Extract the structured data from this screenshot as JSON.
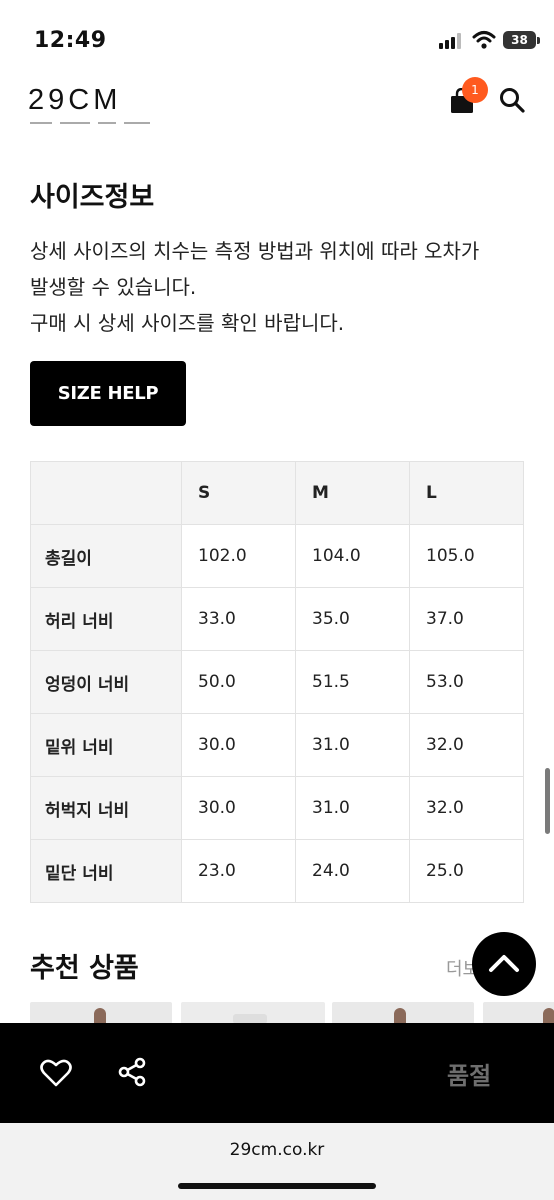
{
  "status_bar": {
    "time": "12:49",
    "battery": "38"
  },
  "header": {
    "logo": "29CM",
    "cart_count": "1"
  },
  "size_info": {
    "title": "사이즈정보",
    "desc_line1": "상세 사이즈의 치수는 측정 방법과 위치에 따라 오차가",
    "desc_line2": "발생할 수 있습니다.",
    "desc_line3": "구매 시 상세 사이즈를 확인 바랍니다.",
    "help_button": "SIZE HELP"
  },
  "size_table": {
    "headers": [
      "",
      "S",
      "M",
      "L"
    ],
    "rows": [
      {
        "label": "총길이",
        "values": [
          "102.0",
          "104.0",
          "105.0"
        ]
      },
      {
        "label": "허리 너비",
        "values": [
          "33.0",
          "35.0",
          "37.0"
        ]
      },
      {
        "label": "엉덩이 너비",
        "values": [
          "50.0",
          "51.5",
          "53.0"
        ]
      },
      {
        "label": "밑위 너비",
        "values": [
          "30.0",
          "31.0",
          "32.0"
        ]
      },
      {
        "label": "허벅지 너비",
        "values": [
          "30.0",
          "31.0",
          "32.0"
        ]
      },
      {
        "label": "밑단 너비",
        "values": [
          "23.0",
          "24.0",
          "25.0"
        ]
      }
    ]
  },
  "recommended": {
    "title": "추천 상품",
    "more": "더보"
  },
  "action_bar": {
    "status": "품절"
  },
  "browser": {
    "url": "29cm.co.kr"
  },
  "colors": {
    "badge": "#ff5a1f",
    "action_bar": "#000000",
    "soldout_text": "#6e6e6e"
  }
}
